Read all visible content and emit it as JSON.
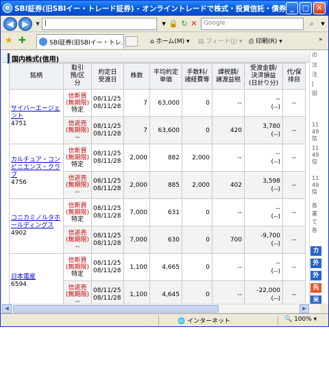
{
  "window": {
    "title": "SBI証券(旧SBIイー・トレード証券) - オンライントレードで株式・投資信託・債券を - - Win...",
    "min_label": "_",
    "max_label": "□",
    "close_label": "✕"
  },
  "address": {
    "url": "|",
    "search_placeholder": "Google"
  },
  "tab": {
    "label": "SBI証券(旧SBIイー・トレ...",
    "home": "ホーム(M)",
    "feeds": "フィード(J)",
    "print": "印刷(R)"
  },
  "section": {
    "title": "国内株式(信用)"
  },
  "table": {
    "headers": {
      "name": "銘柄",
      "type": "取引\n預/区\n分",
      "date": "約定日\n受渡日",
      "qty": "株数",
      "avg": "平均約定\n単価",
      "fee": "手数料/\n諸経費等",
      "tax": "課税額/\n譲渡益税",
      "amount": "受渡金額/\n決済損益\n(日計り分)",
      "kind": "代/保\n排目"
    },
    "stocks": [
      {
        "name": "サイバーエージェント",
        "code": "4751",
        "rows": [
          {
            "t1": "信新買",
            "t2": "(無期限)",
            "t3": "特定",
            "d1": "08/11/25",
            "d2": "08/11/28",
            "qty": "7",
            "avg": "63,000",
            "fee": "0",
            "tax": "--",
            "amt1": "--",
            "amt2": "(--)",
            "kind": "--"
          },
          {
            "t1": "信返売",
            "t2": "(無期限)",
            "t3": "--",
            "d1": "08/11/25",
            "d2": "08/11/28",
            "qty": "7",
            "avg": "63,600",
            "fee": "0",
            "tax": "420",
            "amt1": "3,780",
            "amt2": "(--)",
            "kind": "--"
          }
        ]
      },
      {
        "name": "カルチュア・コンビニエンス・クラブ",
        "code": "4756",
        "rows": [
          {
            "t1": "信新買",
            "t2": "(無期限)",
            "t3": "特定",
            "d1": "08/11/25",
            "d2": "08/11/28",
            "qty": "2,000",
            "avg": "882",
            "fee": "2,000",
            "tax": "--",
            "amt1": "--",
            "amt2": "(--)",
            "kind": "--"
          },
          {
            "t1": "信返売",
            "t2": "(無期限)",
            "t3": "--",
            "d1": "08/11/25",
            "d2": "08/11/28",
            "qty": "2,000",
            "avg": "885",
            "fee": "2,000",
            "tax": "402",
            "amt1": "3,598",
            "amt2": "(--)",
            "kind": "--"
          }
        ]
      },
      {
        "name": "コニカミノルタホールディングス",
        "code": "4902",
        "rows": [
          {
            "t1": "信新買",
            "t2": "(無期限)",
            "t3": "特定",
            "d1": "08/11/25",
            "d2": "08/11/28",
            "qty": "7,000",
            "avg": "631",
            "fee": "0",
            "tax": "--",
            "amt1": "--",
            "amt2": "(--)",
            "kind": "--"
          },
          {
            "t1": "信返売",
            "t2": "(無期限)",
            "t3": "--",
            "d1": "08/11/25",
            "d2": "08/11/28",
            "qty": "7,000",
            "avg": "630",
            "fee": "0",
            "tax": "700",
            "amt1": "-9,700",
            "amt2": "(--)",
            "kind": "--"
          }
        ]
      },
      {
        "name": "日本電産",
        "code": "6594",
        "rows": [
          {
            "t1": "信新買",
            "t2": "(無期限)",
            "t3": "特定",
            "d1": "08/11/25",
            "d2": "08/11/28",
            "qty": "1,100",
            "avg": "4,665",
            "fee": "0",
            "tax": "--",
            "amt1": "--",
            "amt2": "(--)",
            "kind": "--"
          },
          {
            "t1": "信返売",
            "t2": "(無期限)",
            "t3": "--",
            "d1": "08/11/25",
            "d2": "08/11/28",
            "qty": "1,100",
            "avg": "4,645",
            "fee": "0",
            "tax": "--",
            "amt1": "-22,000",
            "amt2": "(--)",
            "kind": "--"
          }
        ]
      }
    ]
  },
  "sidebar": {
    "texts": [
      "の",
      "注",
      "注",
      "[",
      "旧",
      "11",
      "49",
      "信",
      "11",
      "49",
      "信",
      "11",
      "49",
      "信",
      "各",
      "業",
      "て",
      "各"
    ],
    "buttons": [
      "カ",
      "外",
      "外",
      "先",
      "米"
    ]
  },
  "status": {
    "zone": "インターネット",
    "zoom": "100%"
  },
  "colors": {
    "titlebar": "#0a5fe2",
    "link": "#0000cc",
    "trade_type": "#c00000"
  }
}
